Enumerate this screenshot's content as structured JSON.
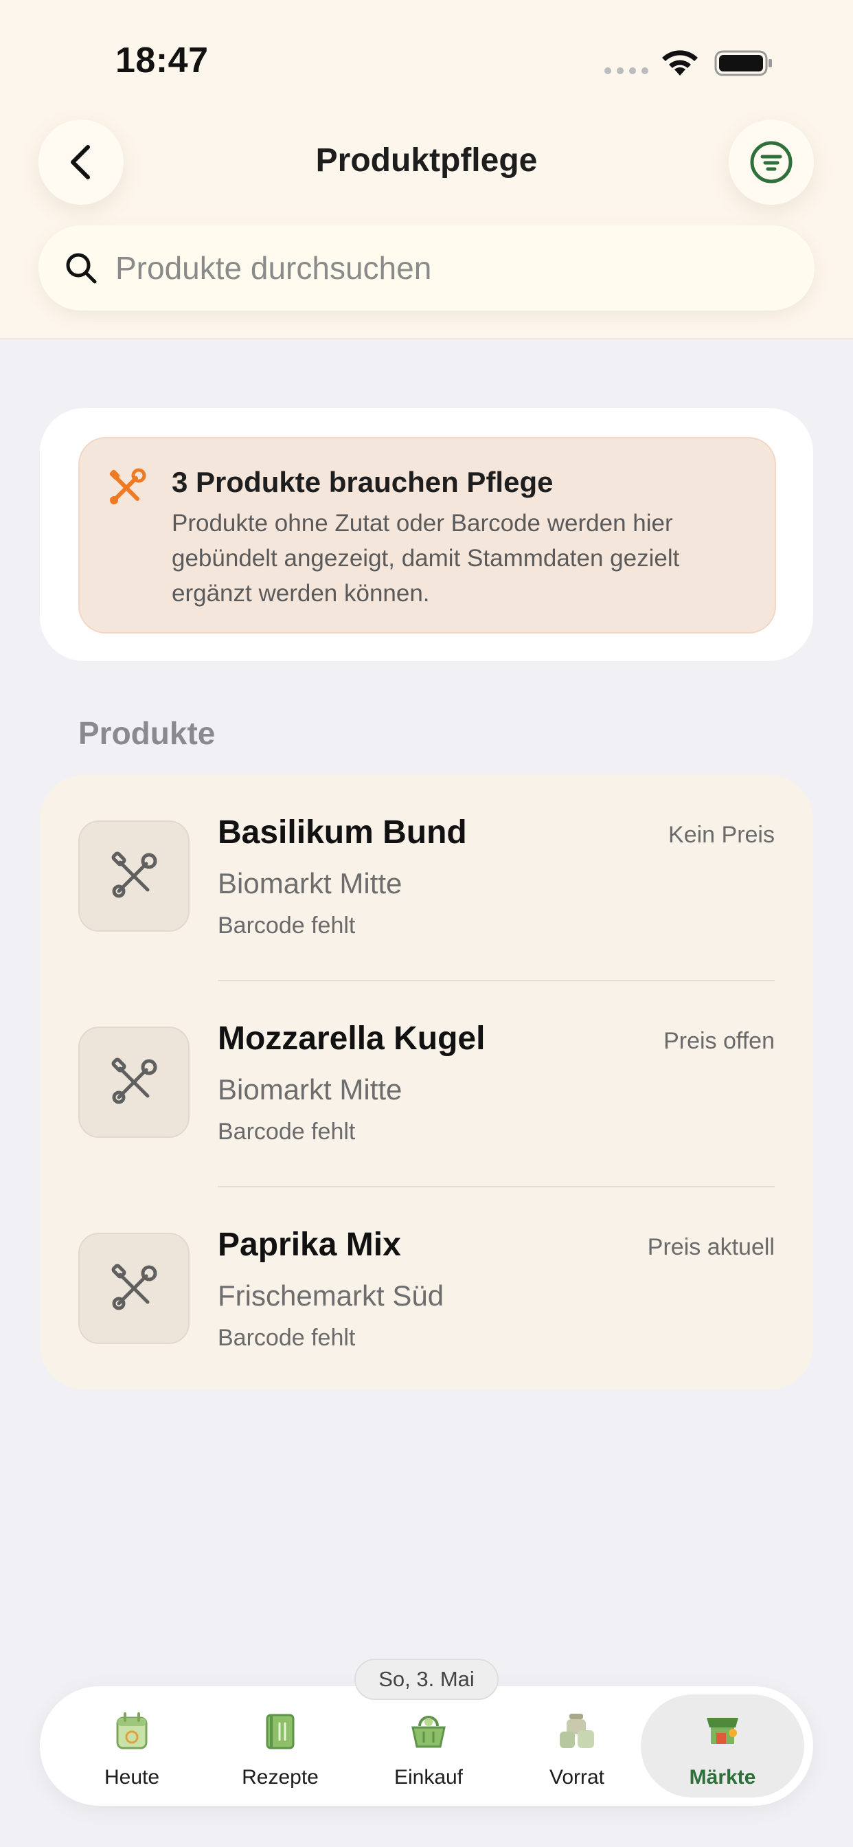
{
  "status_bar": {
    "time": "18:47"
  },
  "header": {
    "title": "Produktpflege",
    "back_icon": "chevron-left-icon",
    "filter_icon": "filter-lines-icon"
  },
  "search": {
    "placeholder": "Produkte durchsuchen",
    "value": ""
  },
  "info_card": {
    "icon": "tools-icon",
    "title": "3 Produkte brauchen Pflege",
    "text": "Produkte ohne Zutat oder Barcode werden hier gebündelt angezeigt, damit Stammdaten gezielt ergänzt werden können."
  },
  "section": {
    "label": "Produkte"
  },
  "products": [
    {
      "name": "Basilikum Bund",
      "store": "Biomarkt Mitte",
      "status": "Barcode fehlt",
      "price": "Kein Preis"
    },
    {
      "name": "Mozzarella Kugel",
      "store": "Biomarkt Mitte",
      "status": "Barcode fehlt",
      "price": "Preis offen"
    },
    {
      "name": "Paprika Mix",
      "store": "Frischemarkt Süd",
      "status": "Barcode fehlt",
      "price": "Preis aktuell"
    }
  ],
  "date_pill": "So, 3. Mai",
  "tabs": [
    {
      "label": "Heute",
      "icon": "calendar-icon",
      "active": false
    },
    {
      "label": "Rezepte",
      "icon": "recipe-book-icon",
      "active": false
    },
    {
      "label": "Einkauf",
      "icon": "basket-icon",
      "active": false
    },
    {
      "label": "Vorrat",
      "icon": "jars-icon",
      "active": false
    },
    {
      "label": "Märkte",
      "icon": "market-stall-icon",
      "active": true
    }
  ],
  "colors": {
    "accent_green": "#2f6f3a",
    "warning_orange": "#f07a24",
    "header_bg": "#fdf6ec",
    "list_bg": "#f9f2e9"
  }
}
